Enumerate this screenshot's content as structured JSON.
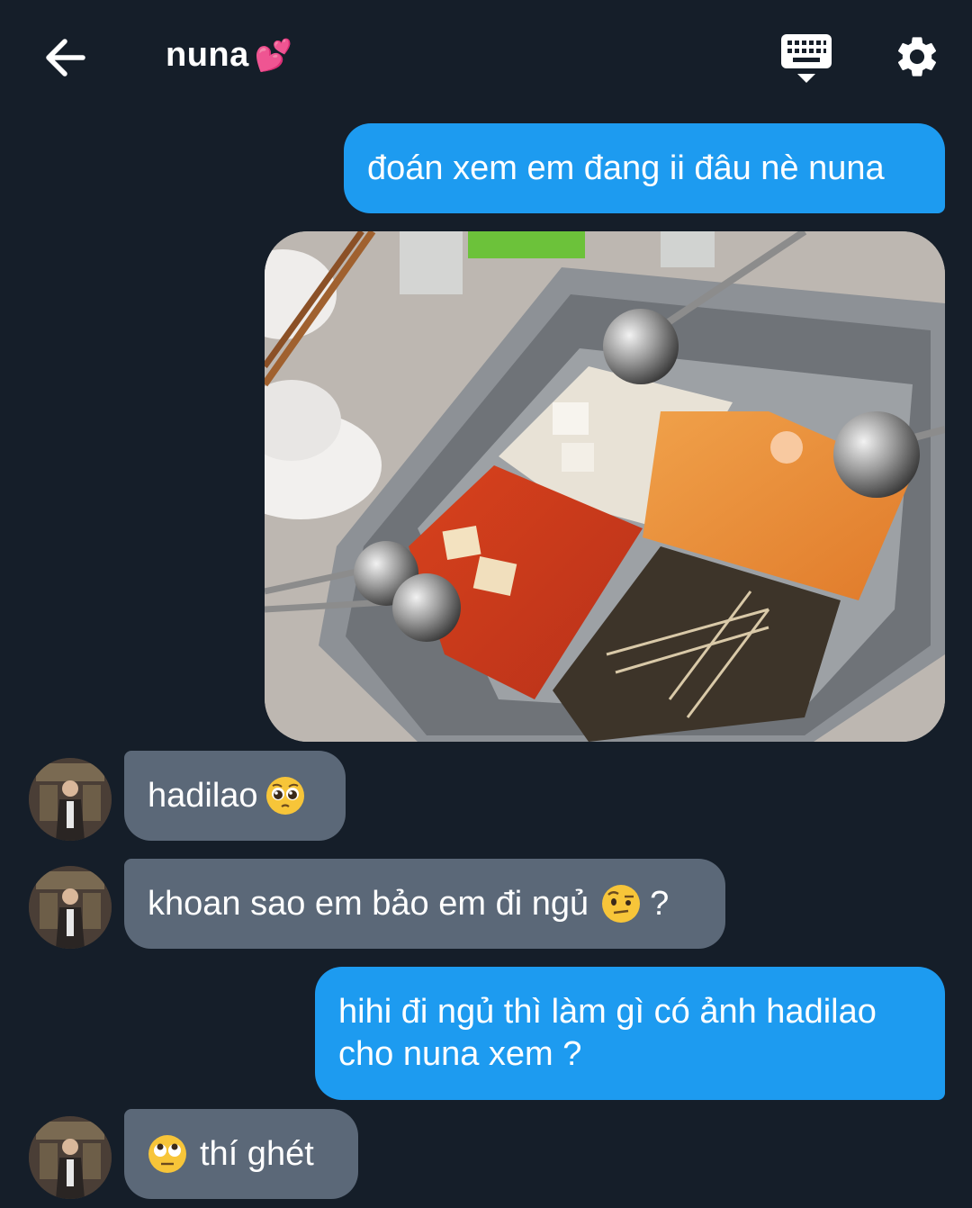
{
  "header": {
    "back_icon": "arrow-left-icon",
    "title": "nuna",
    "title_emoji": "💕",
    "keyboard_icon": "keyboard-icon",
    "settings_icon": "gear-icon"
  },
  "messages": [
    {
      "direction": "outgoing",
      "type": "text",
      "text": "đoán xem em đang ii đâu nè nuna"
    },
    {
      "direction": "outgoing",
      "type": "image",
      "image": "hotpot-photo"
    },
    {
      "direction": "incoming",
      "type": "text",
      "text": "hadilao",
      "emoji": "pleading-face"
    },
    {
      "direction": "incoming",
      "type": "text",
      "text": "khoan sao em bảo em đi ngủ",
      "emoji": "raised-eyebrow-face",
      "suffix": "?"
    },
    {
      "direction": "outgoing",
      "type": "text",
      "line1": "hihi đi ngủ thì làm gì có ảnh hadilao",
      "line2": "cho nuna xem ?"
    },
    {
      "direction": "incoming",
      "type": "text",
      "emoji": "eye-roll-face",
      "text": "thí ghét"
    }
  ],
  "colors": {
    "background": "#151e29",
    "outgoing_bubble": "#1d9bf0",
    "incoming_bubble": "#5b6878"
  }
}
